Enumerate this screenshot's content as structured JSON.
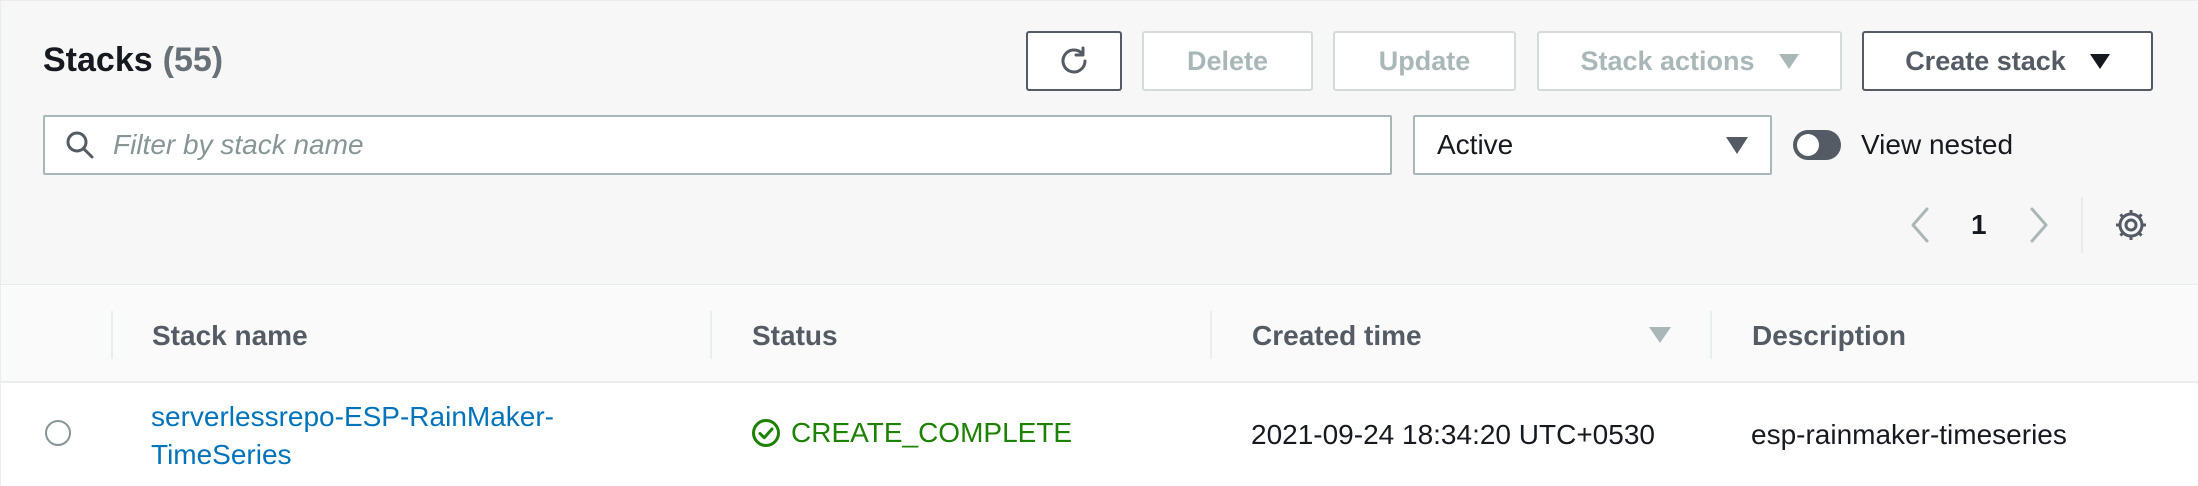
{
  "header": {
    "title": "Stacks",
    "count": "(55)"
  },
  "toolbar": {
    "refresh_icon": "refresh-icon",
    "delete_label": "Delete",
    "update_label": "Update",
    "stack_actions_label": "Stack actions",
    "create_stack_label": "Create stack"
  },
  "filter": {
    "search_placeholder": "Filter by stack name",
    "search_value": "",
    "status_selected": "Active",
    "view_nested_label": "View nested",
    "view_nested_on": false
  },
  "pagination": {
    "current_page": "1"
  },
  "table": {
    "columns": [
      "Stack name",
      "Status",
      "Created time",
      "Description"
    ],
    "sorted_column": "Created time",
    "sort_direction": "descending",
    "rows": [
      {
        "stack_name": "serverlessrepo-ESP-RainMaker-TimeSeries",
        "status": "CREATE_COMPLETE",
        "created_time": "2021-09-24 18:34:20 UTC+0530",
        "description": "esp-rainmaker-timeseries",
        "selected": false
      }
    ]
  },
  "colors": {
    "link": "#0073bb",
    "success": "#1d8102",
    "disabled": "#aab7b8",
    "text": "#16191f"
  }
}
